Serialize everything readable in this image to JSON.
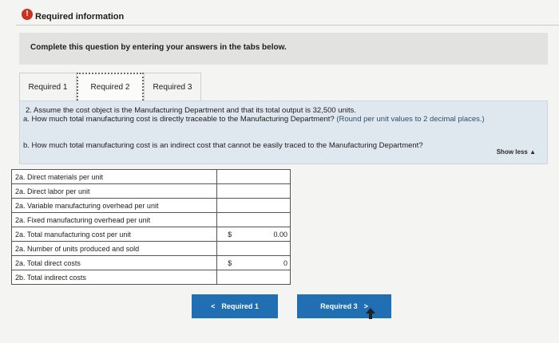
{
  "header": {
    "alert_glyph": "!",
    "title": "Required information"
  },
  "instructions": {
    "text": "Complete this question by entering your answers in the tabs below."
  },
  "tabs": [
    {
      "label": "Required 1"
    },
    {
      "label": "Required 2",
      "active": true
    },
    {
      "label": "Required 3"
    }
  ],
  "question": {
    "main": "2. Assume the cost object is the Manufacturing Department and that its total output is 32,500 units.",
    "part_a": "a. How much total manufacturing cost is directly traceable to the Manufacturing Department?",
    "part_a_note": "(Round per unit values to 2 decimal places.)",
    "part_b": "b. How much total manufacturing cost is an indirect cost that cannot be easily traced to the Manufacturing Department?",
    "show_less": "Show less"
  },
  "table": {
    "rows": [
      {
        "label": "2a. Direct materials per unit",
        "dollar": "",
        "value": ""
      },
      {
        "label": "2a. Direct labor per unit",
        "dollar": "",
        "value": ""
      },
      {
        "label": "2a. Variable manufacturing overhead per unit",
        "dollar": "",
        "value": ""
      },
      {
        "label": "2a. Fixed manufacturing overhead per unit",
        "dollar": "",
        "value": ""
      },
      {
        "label": "2a. Total manufacturing cost per unit",
        "dollar": "$",
        "value": "0.00"
      },
      {
        "label": "2a. Number of units produced and sold",
        "dollar": "",
        "value": ""
      },
      {
        "label": "2a. Total direct costs",
        "dollar": "$",
        "value": "0"
      },
      {
        "label": "2b. Total indirect costs",
        "dollar": "",
        "value": ""
      }
    ]
  },
  "nav": {
    "prev_glyph": "<",
    "prev_label": "Required 1",
    "next_label": "Required 3",
    "next_glyph": ">"
  },
  "colors": {
    "accent": "#1f6fb2",
    "alert": "#c8321f",
    "question_bg": "#dfe8ef"
  }
}
